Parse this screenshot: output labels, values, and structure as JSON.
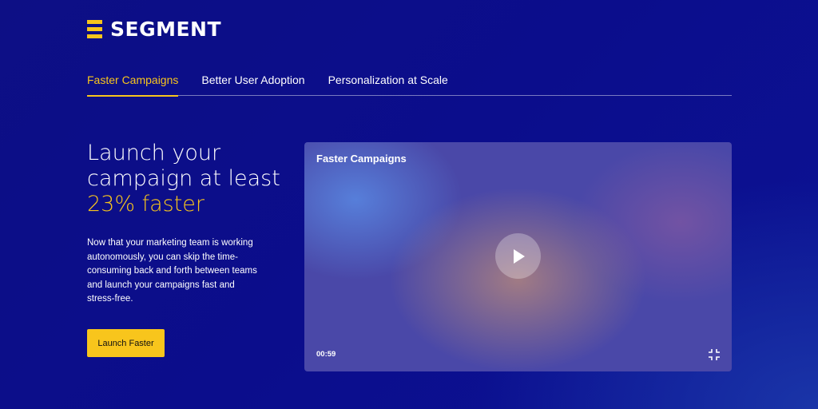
{
  "brand": {
    "name": "SEGMENT",
    "logo_icon": "three-bars-logo-icon",
    "accent_color": "#f8c51c",
    "background_color": "#0d0f85"
  },
  "tabs": [
    {
      "label": "Faster Campaigns",
      "active": true
    },
    {
      "label": "Better User Adoption",
      "active": false
    },
    {
      "label": "Personalization at Scale",
      "active": false
    }
  ],
  "hero": {
    "headline_line1": "Launch your",
    "headline_line2": "campaign at least",
    "headline_accent": "23% faster",
    "body": "Now that your marketing team is working autonomously, you can skip the time-consuming back and forth between teams and launch your campaigns fast and stress-free.",
    "cta_label": "Launch Faster"
  },
  "video": {
    "title": "Faster Campaigns",
    "duration": "00:59",
    "play_icon": "play-icon",
    "collapse_icon": "collapse-icon"
  }
}
